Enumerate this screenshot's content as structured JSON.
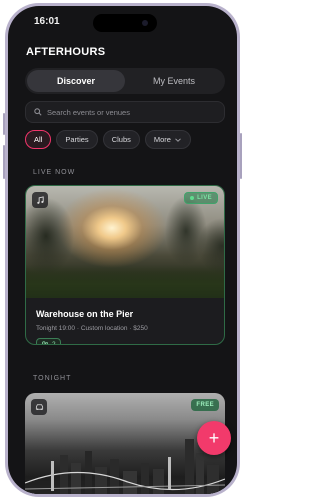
{
  "status": {
    "time": "16:01"
  },
  "app": {
    "title": "AFTERHOURS"
  },
  "tabs": [
    {
      "label": "Discover",
      "active": true
    },
    {
      "label": "My Events",
      "active": false
    }
  ],
  "search": {
    "placeholder": "Search events or venues",
    "value": ""
  },
  "filters": [
    {
      "label": "All",
      "active": true
    },
    {
      "label": "Parties"
    },
    {
      "label": "Clubs"
    },
    {
      "label": "More"
    }
  ],
  "sections": {
    "live_now": "LIVE NOW",
    "tonight": "TONIGHT"
  },
  "events": [
    {
      "title": "Warehouse on the Pier",
      "time": "Tonight 19:00",
      "location": "Custom location",
      "price": "$250",
      "attendees": "2",
      "badge": "LIVE",
      "icon": "music-note-icon"
    },
    {
      "badge": "FREE",
      "icon": "car-icon"
    }
  ],
  "fab": {
    "label": "+"
  },
  "colors": {
    "accent": "#f23a6b",
    "live": "#3fa36a",
    "background": "#141416"
  }
}
